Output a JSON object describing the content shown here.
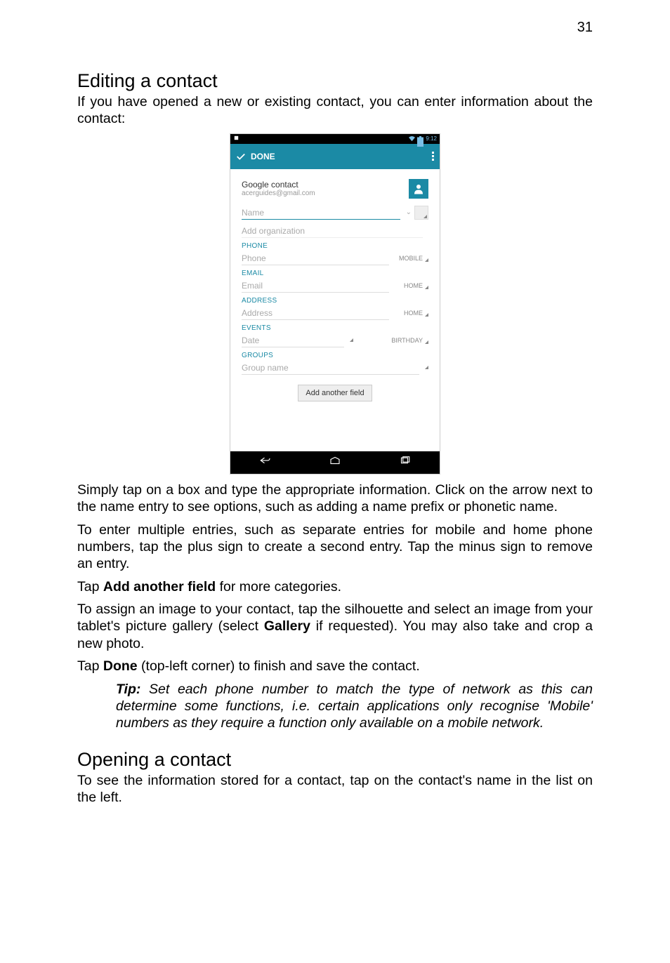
{
  "page_number": "31",
  "h1": "Editing a contact",
  "p1": "If you have opened a new or existing contact, you can enter information about the contact:",
  "p2": "Simply tap on a box and type the appropriate information. Click on the arrow next to the name entry to see options, such as adding a name prefix or phonetic name.",
  "p3": "To enter multiple entries, such as separate entries for mobile and home phone numbers, tap the plus sign to create a second entry. Tap the minus sign to remove an entry.",
  "p4_pre": "Tap ",
  "p4_bold": "Add another field",
  "p4_post": " for more categories.",
  "p5_pre": "To assign an image to your contact, tap the silhouette and select an image from your tablet's picture gallery (select ",
  "p5_bold": "Gallery",
  "p5_post": " if requested). You may also take and crop a new photo.",
  "p6_pre": "Tap ",
  "p6_bold": "Done",
  "p6_post": " (top-left corner) to finish and save the contact.",
  "tip_label": "Tip:",
  "tip_text": " Set each phone number to match the type of network as this can determine some functions, i.e. certain applications only recognise 'Mobile' numbers as they require a function only available on a mobile network.",
  "h2": "Opening a contact",
  "p7": "To see the information stored for a contact, tap on the contact's name in the list on the left.",
  "screenshot": {
    "time": "9:12",
    "done_label": "DONE",
    "account_title": "Google contact",
    "account_sub": "acerguides@gmail.com",
    "name_placeholder": "Name",
    "add_org": "Add organization",
    "sec_phone": "PHONE",
    "phone_placeholder": "Phone",
    "phone_type": "MOBILE",
    "sec_email": "EMAIL",
    "email_placeholder": "Email",
    "email_type": "HOME",
    "sec_address": "ADDRESS",
    "address_placeholder": "Address",
    "address_type": "HOME",
    "sec_events": "EVENTS",
    "date_placeholder": "Date",
    "date_type": "BIRTHDAY",
    "sec_groups": "GROUPS",
    "group_placeholder": "Group name",
    "add_field": "Add another field"
  }
}
